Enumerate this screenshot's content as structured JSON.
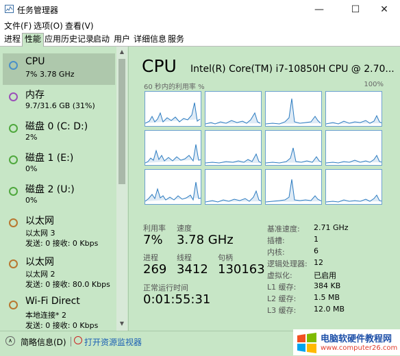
{
  "window": {
    "title": "任务管理器"
  },
  "menu": [
    "文件(F)",
    "选项(O)",
    "查看(V)"
  ],
  "tabs": [
    "进程",
    "性能",
    "应用历史记录",
    "启动",
    "用户",
    "详细信息",
    "服务"
  ],
  "sidebar": [
    {
      "title": "CPU",
      "lines": [
        "7% 3.78 GHz"
      ]
    },
    {
      "title": "内存",
      "lines": [
        "9.7/31.6 GB (31%)"
      ]
    },
    {
      "title": "磁盘 0 (C: D:)",
      "lines": [
        "2%"
      ]
    },
    {
      "title": "磁盘 1 (E:)",
      "lines": [
        "0%"
      ]
    },
    {
      "title": "磁盘 2 (U:)",
      "lines": [
        "0%"
      ]
    },
    {
      "title": "以太网",
      "lines": [
        "以太网 3",
        "发送: 0 接收: 0 Kbps"
      ]
    },
    {
      "title": "以太网",
      "lines": [
        "以太网 2",
        "发送: 0 接收: 80.0 Kbps"
      ]
    },
    {
      "title": "Wi-Fi Direct",
      "lines": [
        "本地连接* 2",
        "发送: 0 接收: 0 Kbps"
      ]
    }
  ],
  "main": {
    "title": "CPU",
    "cpu_name": "Intel(R) Core(TM) i7-10850H CPU @ 2.70...",
    "graph_label": "60 秒内的利用率 %",
    "graph_max": "100%",
    "stats": {
      "util_label": "利用率",
      "util_value": "7%",
      "speed_label": "速度",
      "speed_value": "3.78 GHz",
      "proc_label": "进程",
      "proc_value": "269",
      "thread_label": "线程",
      "thread_value": "3412",
      "handle_label": "句柄",
      "handle_value": "130163",
      "uptime_label": "正常运行时间",
      "uptime_value": "0:01:55:31"
    },
    "specs": [
      {
        "label": "基准速度:",
        "value": "2.71 GHz"
      },
      {
        "label": "插槽:",
        "value": "1"
      },
      {
        "label": "内核:",
        "value": "6"
      },
      {
        "label": "逻辑处理器:",
        "value": "12"
      },
      {
        "label": "虚拟化:",
        "value": "已启用"
      },
      {
        "label": "L1 缓存:",
        "value": "384 KB"
      },
      {
        "label": "L2 缓存:",
        "value": "1.5 MB"
      },
      {
        "label": "L3 缓存:",
        "value": "12.0 MB"
      }
    ]
  },
  "footer": {
    "less_details": "简略信息(D)",
    "resource_monitor": "打开资源监视器"
  },
  "watermark": {
    "title": "电脑软硬件教程网",
    "url": "www.computer26.com"
  },
  "colors": {
    "bg": "#c7e6c6",
    "graph_line": "#2b7bc0",
    "selected": "#aec8ac"
  }
}
